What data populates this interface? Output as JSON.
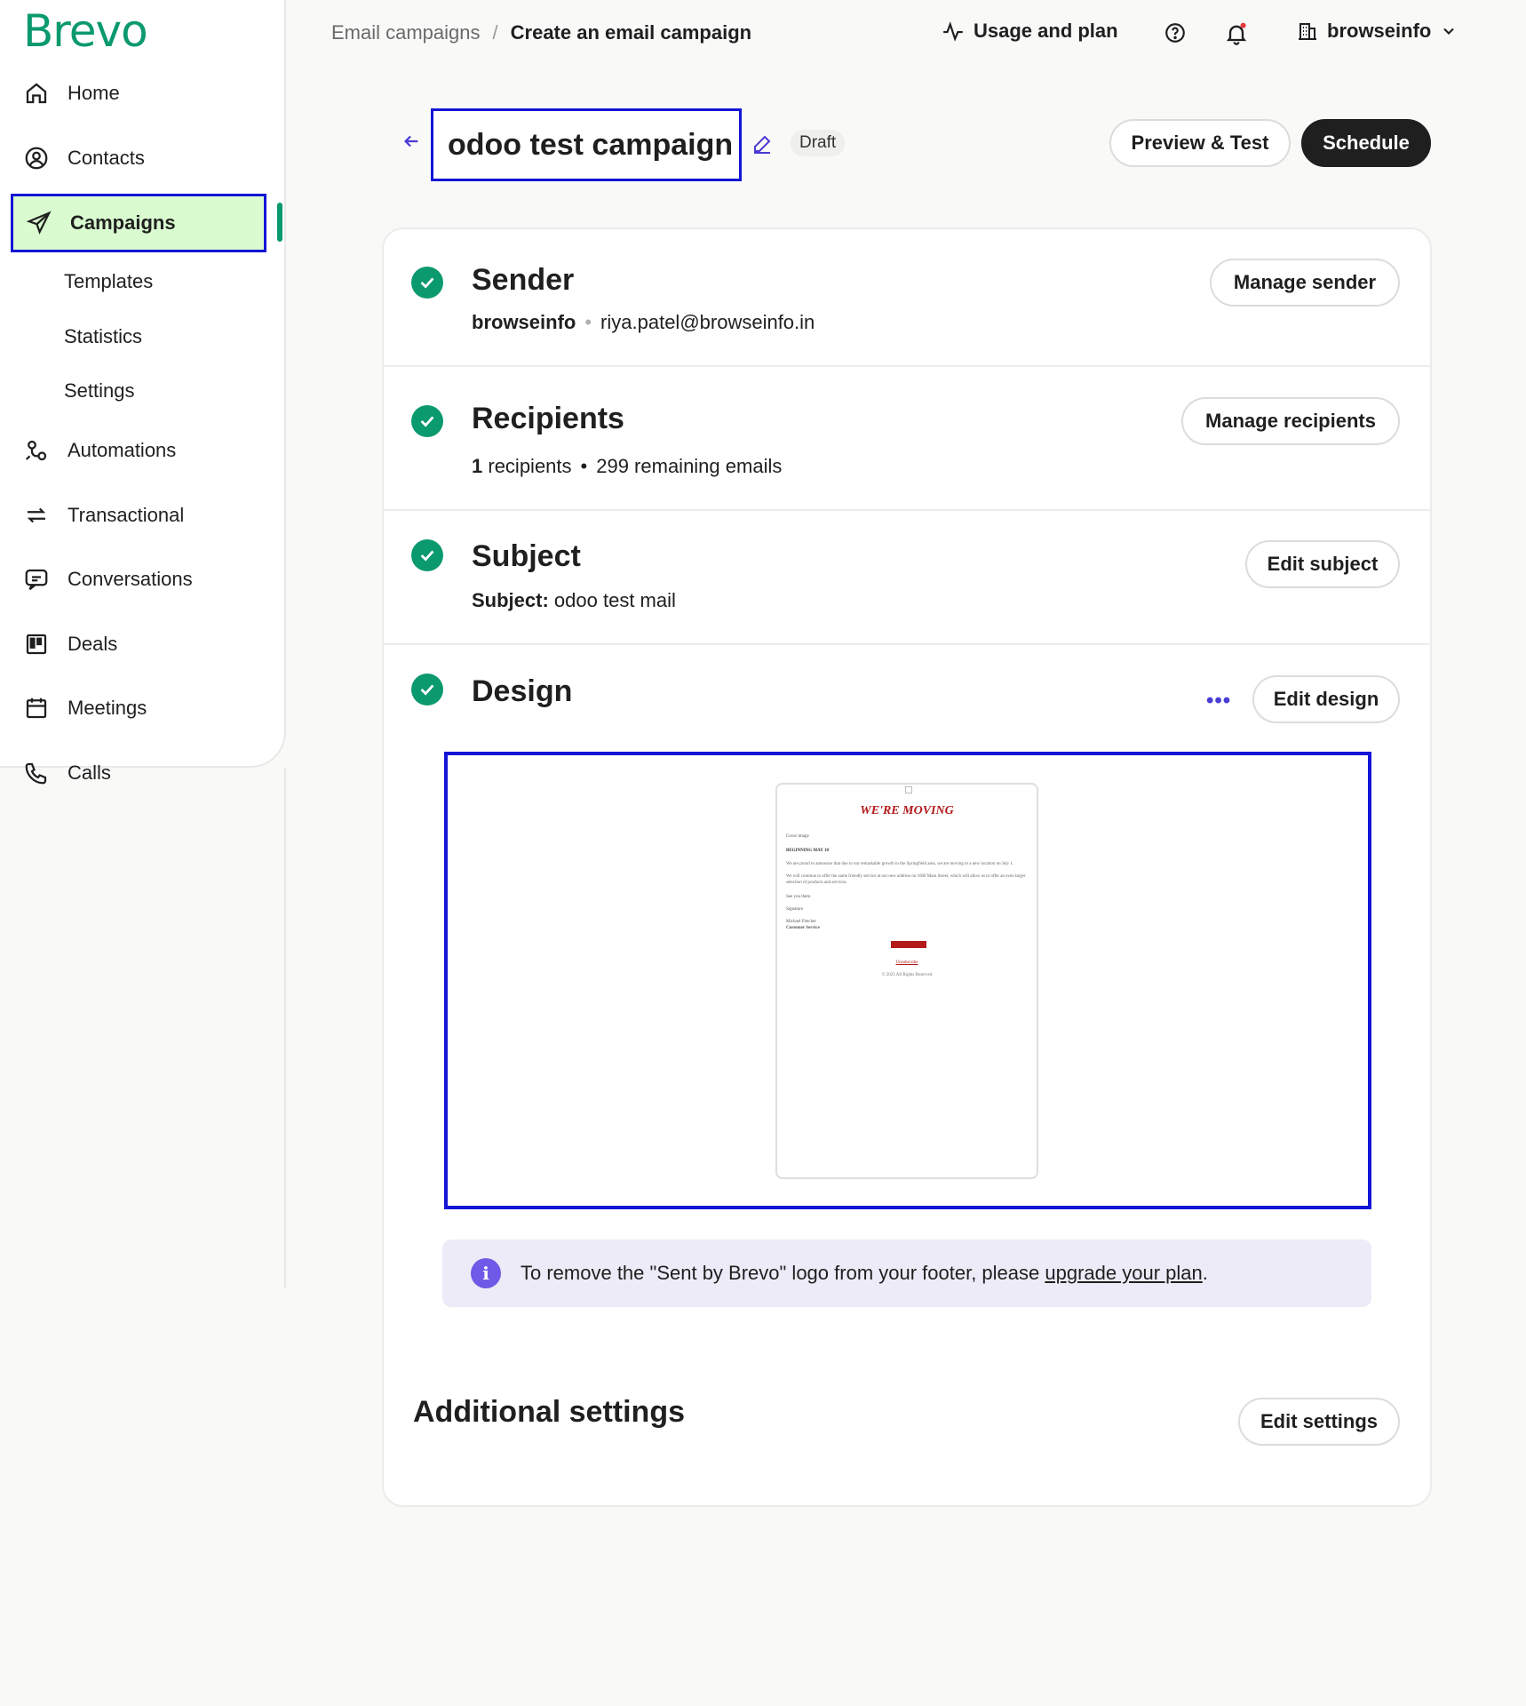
{
  "sidebar": {
    "logo": "Brevo",
    "items": [
      {
        "label": "Home",
        "icon": "home-icon"
      },
      {
        "label": "Contacts",
        "icon": "contacts-icon"
      },
      {
        "label": "Campaigns",
        "icon": "send-icon",
        "active": true
      },
      {
        "label": "Automations",
        "icon": "automations-icon"
      },
      {
        "label": "Transactional",
        "icon": "transactional-icon"
      },
      {
        "label": "Conversations",
        "icon": "chat-icon"
      },
      {
        "label": "Deals",
        "icon": "deals-icon"
      },
      {
        "label": "Meetings",
        "icon": "calendar-icon"
      },
      {
        "label": "Calls",
        "icon": "phone-icon"
      }
    ],
    "campaign_subitems": [
      "Templates",
      "Statistics",
      "Settings"
    ]
  },
  "header": {
    "breadcrumb": [
      "Email campaigns",
      "Create an email campaign"
    ],
    "breadcrumb_separator": "/",
    "usage_label": "Usage and plan",
    "account_name": "browseinfo"
  },
  "campaign": {
    "name": "odoo test campaign",
    "status": "Draft",
    "preview_test_label": "Preview & Test",
    "schedule_label": "Schedule"
  },
  "sections": {
    "sender": {
      "title": "Sender",
      "name": "browseinfo",
      "email": "riya.patel@browseinfo.in",
      "button": "Manage sender"
    },
    "recipients": {
      "title": "Recipients",
      "count": "1",
      "count_suffix": "recipients",
      "remaining": "299 remaining emails",
      "button": "Manage recipients"
    },
    "subject": {
      "title": "Subject",
      "label": "Subject:",
      "value": "odoo test mail",
      "button": "Edit subject"
    },
    "design": {
      "title": "Design",
      "more": "•••",
      "button": "Edit design",
      "preview": {
        "heading": "WE'RE MOVING",
        "cover_alt": "Cover image",
        "date_line": "BEGINNING MAY 10",
        "para1": "We are proud to announce that due to our remarkable growth in the Springfield area, we are moving to a new location on July 1.",
        "para2": "We will continue to offer the same friendly service at our new address on 1600 Main Street, which will allow us to offer an even larger selection of products and services.",
        "see_you": "See you there.",
        "signature_alt": "Signature",
        "signer": "Michael Fletcher",
        "signer_role": "Customer Service",
        "unsubscribe": "Unsubscribe",
        "copyright": "© 2025 All Rights Reserved"
      }
    }
  },
  "info_banner": {
    "text_before": "To remove the \"Sent by Brevo\" logo from your footer, please",
    "link": "upgrade your plan",
    "text_after": "."
  },
  "additional_settings": {
    "title": "Additional settings",
    "button": "Edit settings"
  },
  "colors": {
    "brand": "#0b996e",
    "active_bg": "#d9fbcf",
    "highlight": "#1414d6",
    "dark_button": "#1f1f1f",
    "info_bg": "#edebf7",
    "info_icon": "#6e5ae6"
  }
}
